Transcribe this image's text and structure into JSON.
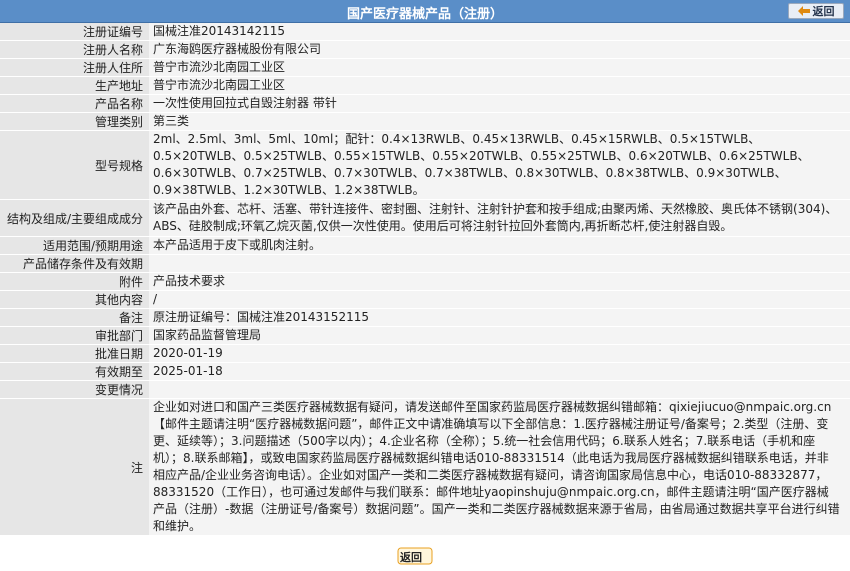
{
  "header": {
    "title": "国产医疗器械产品（注册）",
    "back_label": "返回"
  },
  "fields": [
    {
      "label": "注册证编号",
      "value": "国械注准20143142115"
    },
    {
      "label": "注册人名称",
      "value": "广东海鸥医疗器械股份有限公司"
    },
    {
      "label": "注册人住所",
      "value": "普宁市流沙北南园工业区"
    },
    {
      "label": "生产地址",
      "value": "普宁市流沙北南园工业区"
    },
    {
      "label": "产品名称",
      "value": "一次性使用回拉式自毁注射器 带针"
    },
    {
      "label": "管理类别",
      "value": "第三类"
    },
    {
      "label": "型号规格",
      "value": "2ml、2.5ml、3ml、5ml、10ml；配针：0.4×13RWLB、0.45×13RWLB、0.45×15RWLB、0.5×15TWLB、0.5×20TWLB、0.5×25TWLB、0.55×15TWLB、0.55×20TWLB、0.55×25TWLB、0.6×20TWLB、0.6×25TWLB、0.6×30TWLB、0.7×25TWLB、0.7×30TWLB、0.7×38TWLB、0.8×30TWLB、0.8×38TWLB、0.9×30TWLB、0.9×38TWLB、1.2×30TWLB、1.2×38TWLB。"
    },
    {
      "label": "结构及组成/主要组成成分",
      "value": "该产品由外套、芯杆、活塞、带针连接件、密封圈、注射针、注射针护套和按手组成;由聚丙烯、天然橡胶、奥氏体不锈钢(304)、ABS、硅胶制成;环氧乙烷灭菌,仅供一次性使用。使用后可将注射针拉回外套筒内,再折断芯杆,使注射器自毁。"
    },
    {
      "label": "适用范围/预期用途",
      "value": "本产品适用于皮下或肌肉注射。"
    },
    {
      "label": "产品储存条件及有效期",
      "value": ""
    },
    {
      "label": "附件",
      "value": "产品技术要求"
    },
    {
      "label": "其他内容",
      "value": "/"
    },
    {
      "label": "备注",
      "value": "原注册证编号：国械注准20143152115"
    },
    {
      "label": "审批部门",
      "value": "国家药品监督管理局"
    },
    {
      "label": "批准日期",
      "value": "2020-01-19"
    },
    {
      "label": "有效期至",
      "value": "2025-01-18"
    },
    {
      "label": "变更情况",
      "value": ""
    }
  ],
  "note": {
    "label": "注",
    "text": "企业如对进口和国产三类医疗器械数据有疑问，请发送邮件至国家药监局医疗器械数据纠错邮箱：qixiejiucuo@nmpaic.org.cn【邮件主题请注明“医疗器械数据问题”，邮件正文中请准确填写以下全部信息：1.医疗器械注册证号/备案号；2.类型（注册、变更、延续等）；3.问题描述（500字以内）；4.企业名称（全称）；5.统一社会信用代码；6.联系人姓名；7.联系电话（手机和座机）；8.联系邮箱】，或致电国家药监局医疗器械数据纠错电话010-88331514（此电话为我局医疗器械数据纠错联系电话，并非相应产品/企业业务咨询电话）。企业如对国产一类和二类医疗器械数据有疑问，请咨询国家局信息中心，电话010-88332877，88331520（工作日），也可通过发邮件与我们联系：邮件地址yaopinshuju@nmpaic.org.cn，邮件主题请注明“国产医疗器械产品（注册）-数据（注册证号/备案号）数据问题”。国产一类和二类医疗器械数据来源于省局，由省局通过数据共享平台进行纠错和维护。"
  },
  "footer": {
    "back_label": "返回"
  },
  "colors": {
    "header_bg": "#5a8ec8",
    "label_bg": "#e6e6e6",
    "value_bg": "#f4f4f4",
    "back_button_accent": "#f0a020"
  }
}
